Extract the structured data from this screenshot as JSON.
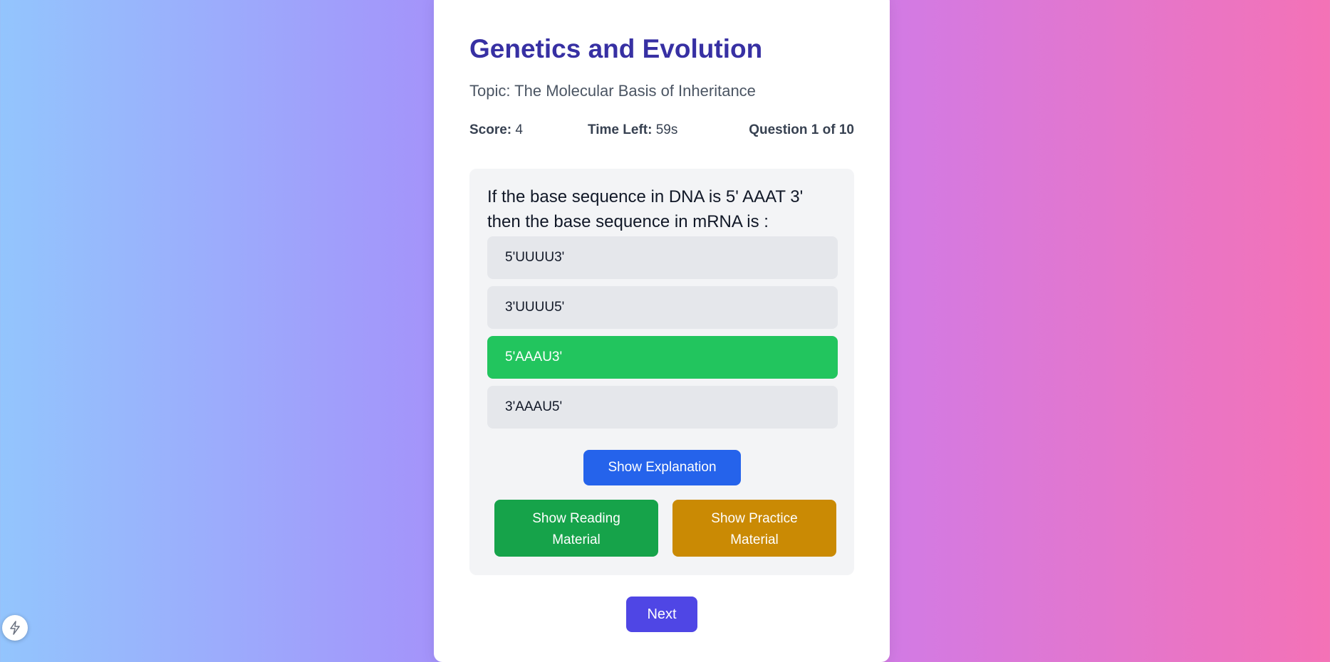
{
  "quiz": {
    "title": "Genetics and Evolution",
    "topic": "Topic: The Molecular Basis of Inheritance",
    "score_label": "Score:",
    "score_value": "4",
    "time_label": "Time Left:",
    "time_value": "59s",
    "question_progress": "Question 1 of 10",
    "question_text": "If the base sequence in DNA is 5' AAAT 3' then the base sequence in mRNA is :",
    "options": [
      {
        "label": "5'UUUU3'"
      },
      {
        "label": "3'UUUU5'"
      },
      {
        "label": "5'AAAU3'",
        "state": "correct"
      },
      {
        "label": "3'AAAU5'"
      }
    ],
    "buttons": {
      "explanation": "Show Explanation",
      "reading": "Show Reading Material",
      "practice": "Show Practice Material",
      "next": "Next"
    }
  },
  "colors": {
    "title": "#3730a3",
    "correct": "#22c55e",
    "explanation_button": "#2563eb",
    "reading_button": "#16a34a",
    "practice_button": "#ca8a04",
    "next_button": "#4f46e5"
  },
  "icons": {
    "corner_badge": "lightning-bolt-icon"
  }
}
